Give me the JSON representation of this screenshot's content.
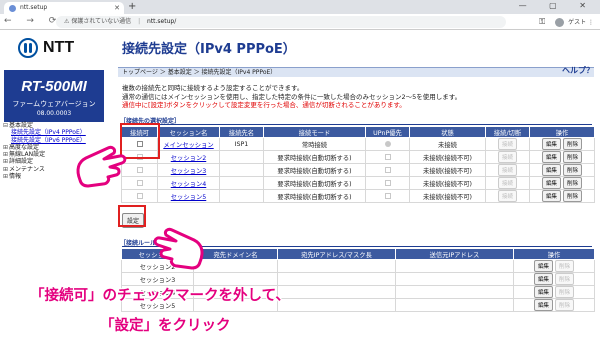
{
  "browser": {
    "tab_title": "ntt.setup",
    "new_tab": "+",
    "window_controls": "—  ▢  ✕",
    "nav_icons": "←  →  ⟳",
    "security_label": "保護されていない通信",
    "url": "ntt.setup/",
    "guest_label": "ゲスト"
  },
  "sidebar": {
    "logo_text": "NTT",
    "model": "RT-500MI",
    "fw_label": "ファームウェアバージョン",
    "fw_version": "08.00.0003",
    "tree": [
      {
        "label": "基本設定",
        "mark": "⊟",
        "sub": false,
        "link": false
      },
      {
        "label": "接続先設定（IPv4 PPPoE）",
        "mark": "",
        "sub": true,
        "link": true
      },
      {
        "label": "接続先設定（IPv6 PPPoE）",
        "mark": "",
        "sub": true,
        "link": true
      },
      {
        "label": "高度な設定",
        "mark": "⊞",
        "sub": false,
        "link": false
      },
      {
        "label": "無線LAN設定",
        "mark": "⊞",
        "sub": false,
        "link": false
      },
      {
        "label": "詳細設定",
        "mark": "⊞",
        "sub": false,
        "link": false
      },
      {
        "label": "メンテナンス",
        "mark": "⊞",
        "sub": false,
        "link": false
      },
      {
        "label": "情報",
        "mark": "⊞",
        "sub": false,
        "link": false
      }
    ]
  },
  "main": {
    "title": "接続先設定（IPv4 PPPoE）",
    "breadcrumb": "トップページ ＞ 基本設定 ＞ 接続先設定（IPv4 PPPoE）",
    "help": "ヘルプ？",
    "desc1": "複数の接続先と同時に接続するよう設定することができます。",
    "desc2": "通常の通信にはメインセッションを使用し、指定した特定の条件に一致した場合のみセッション2〜5を使用します。",
    "desc3": "通信中に[設定]ボタンをクリックして設定変更を行った場合、通信が切断されることがあります。",
    "section1_title": "［接続先の選択設定］",
    "section2_title": "［接続ルール］",
    "set_button": "設定"
  },
  "sessions_table": {
    "headers": [
      "接続可",
      "セッション名",
      "接続先名",
      "接続モード",
      "UPnP優先",
      "状態",
      "接続/切断",
      "操作"
    ],
    "rows": [
      {
        "name": "メインセッション",
        "dest": "ISP1",
        "mode": "常時接続",
        "status": "未接続",
        "conn": "接続",
        "edit": "編集",
        "del": "削除"
      },
      {
        "name": "セッション2",
        "dest": "",
        "mode": "要求時接続(自動切断する)",
        "status": "未接続(接続不可)",
        "conn": "接続",
        "edit": "編集",
        "del": "削除"
      },
      {
        "name": "セッション3",
        "dest": "",
        "mode": "要求時接続(自動切断する)",
        "status": "未接続(接続不可)",
        "conn": "接続",
        "edit": "編集",
        "del": "削除"
      },
      {
        "name": "セッション4",
        "dest": "",
        "mode": "要求時接続(自動切断する)",
        "status": "未接続(接続不可)",
        "conn": "接続",
        "edit": "編集",
        "del": "削除"
      },
      {
        "name": "セッション5",
        "dest": "",
        "mode": "要求時接続(自動切断する)",
        "status": "未接続(接続不可)",
        "conn": "接続",
        "edit": "編集",
        "del": "削除"
      }
    ]
  },
  "rules_table": {
    "headers": [
      "セッション名",
      "宛先ドメイン名",
      "宛先IPアドレス/マスク長",
      "送信元IPアドレス",
      "操作"
    ],
    "rows": [
      {
        "name": "セッション2",
        "edit": "編集",
        "del": "削除"
      },
      {
        "name": "セッション3",
        "edit": "編集",
        "del": "削除"
      },
      {
        "name": "セッション4",
        "edit": "編集",
        "del": "削除"
      },
      {
        "name": "セッション5",
        "edit": "編集",
        "del": "削除"
      }
    ]
  },
  "overlay": {
    "caption1": "「接続可」のチェックマークを外して、",
    "caption2": "「設定」をクリック"
  },
  "colors": {
    "accent": "#1e3c91",
    "header": "#3c5aa0",
    "warning": "#e00000",
    "annotation": "#e4007f",
    "highlight": "#e02020"
  }
}
